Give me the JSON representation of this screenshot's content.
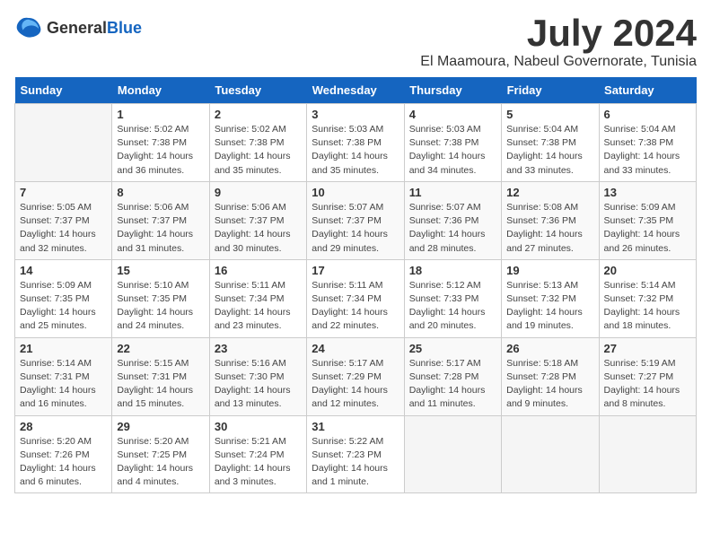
{
  "logo": {
    "text_general": "General",
    "text_blue": "Blue"
  },
  "title": "July 2024",
  "subtitle": "El Maamoura, Nabeul Governorate, Tunisia",
  "days_header": [
    "Sunday",
    "Monday",
    "Tuesday",
    "Wednesday",
    "Thursday",
    "Friday",
    "Saturday"
  ],
  "weeks": [
    [
      {
        "day": "",
        "empty": true
      },
      {
        "day": "1",
        "sunrise": "Sunrise: 5:02 AM",
        "sunset": "Sunset: 7:38 PM",
        "daylight": "Daylight: 14 hours and 36 minutes."
      },
      {
        "day": "2",
        "sunrise": "Sunrise: 5:02 AM",
        "sunset": "Sunset: 7:38 PM",
        "daylight": "Daylight: 14 hours and 35 minutes."
      },
      {
        "day": "3",
        "sunrise": "Sunrise: 5:03 AM",
        "sunset": "Sunset: 7:38 PM",
        "daylight": "Daylight: 14 hours and 35 minutes."
      },
      {
        "day": "4",
        "sunrise": "Sunrise: 5:03 AM",
        "sunset": "Sunset: 7:38 PM",
        "daylight": "Daylight: 14 hours and 34 minutes."
      },
      {
        "day": "5",
        "sunrise": "Sunrise: 5:04 AM",
        "sunset": "Sunset: 7:38 PM",
        "daylight": "Daylight: 14 hours and 33 minutes."
      },
      {
        "day": "6",
        "sunrise": "Sunrise: 5:04 AM",
        "sunset": "Sunset: 7:38 PM",
        "daylight": "Daylight: 14 hours and 33 minutes."
      }
    ],
    [
      {
        "day": "7",
        "sunrise": "Sunrise: 5:05 AM",
        "sunset": "Sunset: 7:37 PM",
        "daylight": "Daylight: 14 hours and 32 minutes."
      },
      {
        "day": "8",
        "sunrise": "Sunrise: 5:06 AM",
        "sunset": "Sunset: 7:37 PM",
        "daylight": "Daylight: 14 hours and 31 minutes."
      },
      {
        "day": "9",
        "sunrise": "Sunrise: 5:06 AM",
        "sunset": "Sunset: 7:37 PM",
        "daylight": "Daylight: 14 hours and 30 minutes."
      },
      {
        "day": "10",
        "sunrise": "Sunrise: 5:07 AM",
        "sunset": "Sunset: 7:37 PM",
        "daylight": "Daylight: 14 hours and 29 minutes."
      },
      {
        "day": "11",
        "sunrise": "Sunrise: 5:07 AM",
        "sunset": "Sunset: 7:36 PM",
        "daylight": "Daylight: 14 hours and 28 minutes."
      },
      {
        "day": "12",
        "sunrise": "Sunrise: 5:08 AM",
        "sunset": "Sunset: 7:36 PM",
        "daylight": "Daylight: 14 hours and 27 minutes."
      },
      {
        "day": "13",
        "sunrise": "Sunrise: 5:09 AM",
        "sunset": "Sunset: 7:35 PM",
        "daylight": "Daylight: 14 hours and 26 minutes."
      }
    ],
    [
      {
        "day": "14",
        "sunrise": "Sunrise: 5:09 AM",
        "sunset": "Sunset: 7:35 PM",
        "daylight": "Daylight: 14 hours and 25 minutes."
      },
      {
        "day": "15",
        "sunrise": "Sunrise: 5:10 AM",
        "sunset": "Sunset: 7:35 PM",
        "daylight": "Daylight: 14 hours and 24 minutes."
      },
      {
        "day": "16",
        "sunrise": "Sunrise: 5:11 AM",
        "sunset": "Sunset: 7:34 PM",
        "daylight": "Daylight: 14 hours and 23 minutes."
      },
      {
        "day": "17",
        "sunrise": "Sunrise: 5:11 AM",
        "sunset": "Sunset: 7:34 PM",
        "daylight": "Daylight: 14 hours and 22 minutes."
      },
      {
        "day": "18",
        "sunrise": "Sunrise: 5:12 AM",
        "sunset": "Sunset: 7:33 PM",
        "daylight": "Daylight: 14 hours and 20 minutes."
      },
      {
        "day": "19",
        "sunrise": "Sunrise: 5:13 AM",
        "sunset": "Sunset: 7:32 PM",
        "daylight": "Daylight: 14 hours and 19 minutes."
      },
      {
        "day": "20",
        "sunrise": "Sunrise: 5:14 AM",
        "sunset": "Sunset: 7:32 PM",
        "daylight": "Daylight: 14 hours and 18 minutes."
      }
    ],
    [
      {
        "day": "21",
        "sunrise": "Sunrise: 5:14 AM",
        "sunset": "Sunset: 7:31 PM",
        "daylight": "Daylight: 14 hours and 16 minutes."
      },
      {
        "day": "22",
        "sunrise": "Sunrise: 5:15 AM",
        "sunset": "Sunset: 7:31 PM",
        "daylight": "Daylight: 14 hours and 15 minutes."
      },
      {
        "day": "23",
        "sunrise": "Sunrise: 5:16 AM",
        "sunset": "Sunset: 7:30 PM",
        "daylight": "Daylight: 14 hours and 13 minutes."
      },
      {
        "day": "24",
        "sunrise": "Sunrise: 5:17 AM",
        "sunset": "Sunset: 7:29 PM",
        "daylight": "Daylight: 14 hours and 12 minutes."
      },
      {
        "day": "25",
        "sunrise": "Sunrise: 5:17 AM",
        "sunset": "Sunset: 7:28 PM",
        "daylight": "Daylight: 14 hours and 11 minutes."
      },
      {
        "day": "26",
        "sunrise": "Sunrise: 5:18 AM",
        "sunset": "Sunset: 7:28 PM",
        "daylight": "Daylight: 14 hours and 9 minutes."
      },
      {
        "day": "27",
        "sunrise": "Sunrise: 5:19 AM",
        "sunset": "Sunset: 7:27 PM",
        "daylight": "Daylight: 14 hours and 8 minutes."
      }
    ],
    [
      {
        "day": "28",
        "sunrise": "Sunrise: 5:20 AM",
        "sunset": "Sunset: 7:26 PM",
        "daylight": "Daylight: 14 hours and 6 minutes."
      },
      {
        "day": "29",
        "sunrise": "Sunrise: 5:20 AM",
        "sunset": "Sunset: 7:25 PM",
        "daylight": "Daylight: 14 hours and 4 minutes."
      },
      {
        "day": "30",
        "sunrise": "Sunrise: 5:21 AM",
        "sunset": "Sunset: 7:24 PM",
        "daylight": "Daylight: 14 hours and 3 minutes."
      },
      {
        "day": "31",
        "sunrise": "Sunrise: 5:22 AM",
        "sunset": "Sunset: 7:23 PM",
        "daylight": "Daylight: 14 hours and 1 minute."
      },
      {
        "day": "",
        "empty": true
      },
      {
        "day": "",
        "empty": true
      },
      {
        "day": "",
        "empty": true
      }
    ]
  ]
}
